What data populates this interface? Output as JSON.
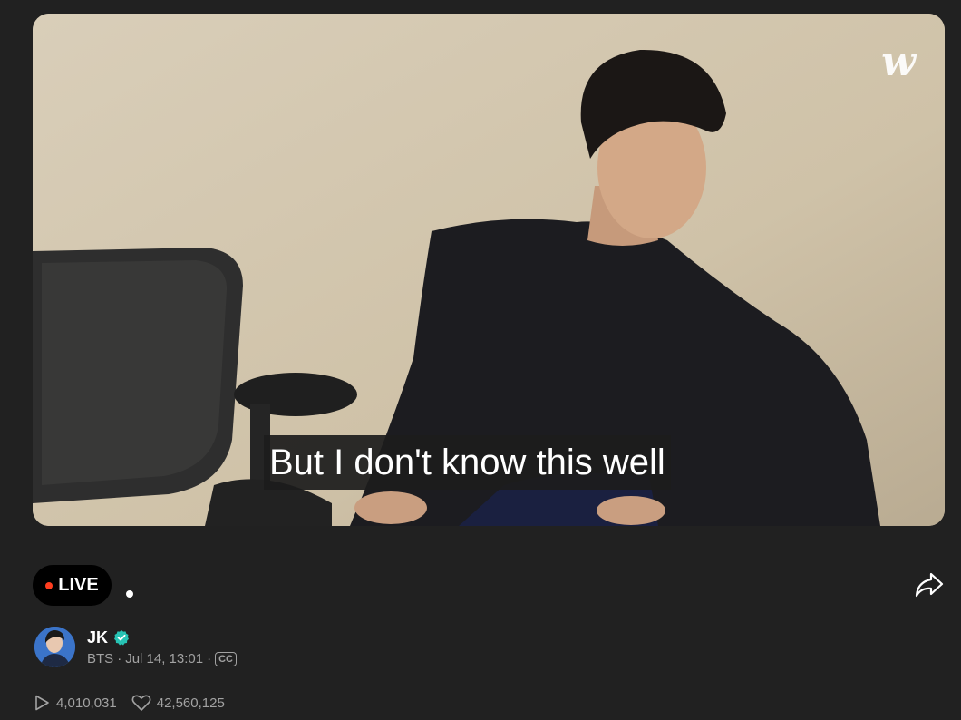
{
  "player": {
    "logo_text": "w",
    "subtitle": "But I don't know this well"
  },
  "live_badge": {
    "label": "LIVE",
    "dot_color": "#ff3d1f"
  },
  "artist": {
    "name": "JK",
    "group": "BTS",
    "separator": "·",
    "date": "Jul 14, 13:01",
    "cc_label": "CC"
  },
  "stats": {
    "plays": "4,010,031",
    "likes": "42,560,125"
  },
  "icons": {
    "share": "share-icon",
    "play": "play-icon",
    "heart": "heart-icon",
    "verified": "verified-badge-icon"
  },
  "colors": {
    "background": "#212121",
    "secondary_text": "#a2a2a2",
    "verified": "#27c3b4"
  }
}
